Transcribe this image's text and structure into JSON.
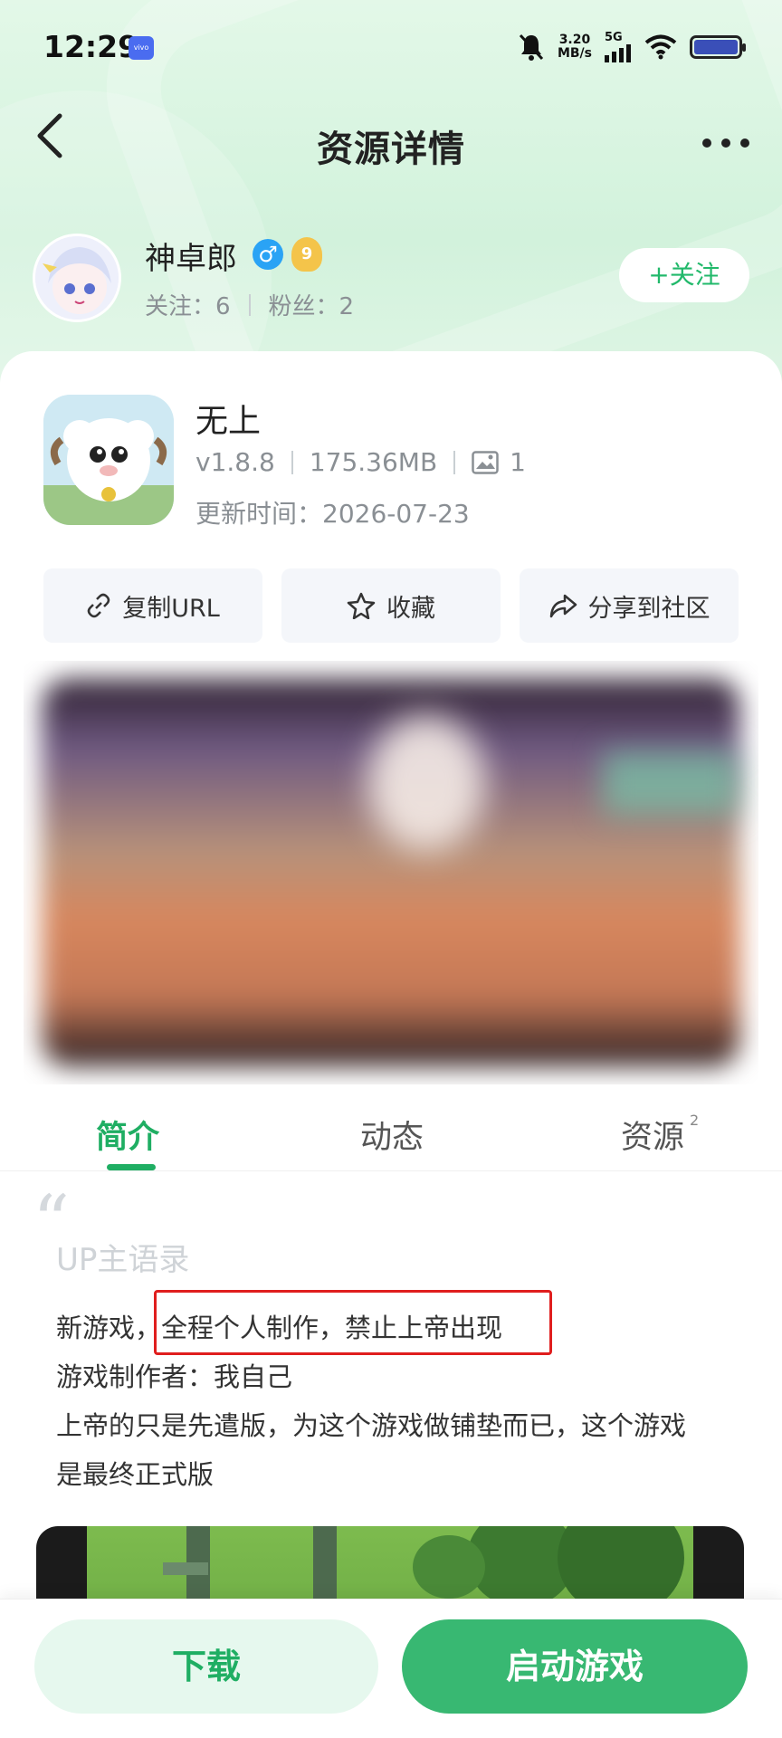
{
  "status": {
    "time": "12:29",
    "net_speed_value": "3.20",
    "net_speed_unit": "MB/s",
    "network": "5G"
  },
  "nav": {
    "title": "资源详情"
  },
  "author": {
    "name": "神卓郎",
    "level": "9",
    "follow_label": "关注：6",
    "fans_label": "粉丝：2",
    "follow_button": "+关注"
  },
  "app": {
    "name": "无上",
    "version": "v1.8.8",
    "size": "175.36MB",
    "image_count": "1",
    "update_time": "更新时间：2026-07-23"
  },
  "actions": {
    "copy_url": "复制URL",
    "favorite": "收藏",
    "share": "分享到社区"
  },
  "tabs": [
    {
      "label": "简介",
      "active": true
    },
    {
      "label": "动态",
      "active": false
    },
    {
      "label": "资源",
      "count": "2",
      "active": false
    }
  ],
  "intro": {
    "quote_mark": "“",
    "title": "UP主语录",
    "lines": [
      "新游戏，全程个人制作，禁止上帝出现",
      "游戏制作者：我自己",
      "上帝的只是先遣版，为这个游戏做铺垫而已，这个游戏",
      "是最终正式版"
    ]
  },
  "bottom": {
    "download": "下载",
    "launch": "启动游戏"
  },
  "colors": {
    "accent": "#1fae63",
    "launch_bg": "#38b872",
    "highlight": "#e01e1e"
  }
}
